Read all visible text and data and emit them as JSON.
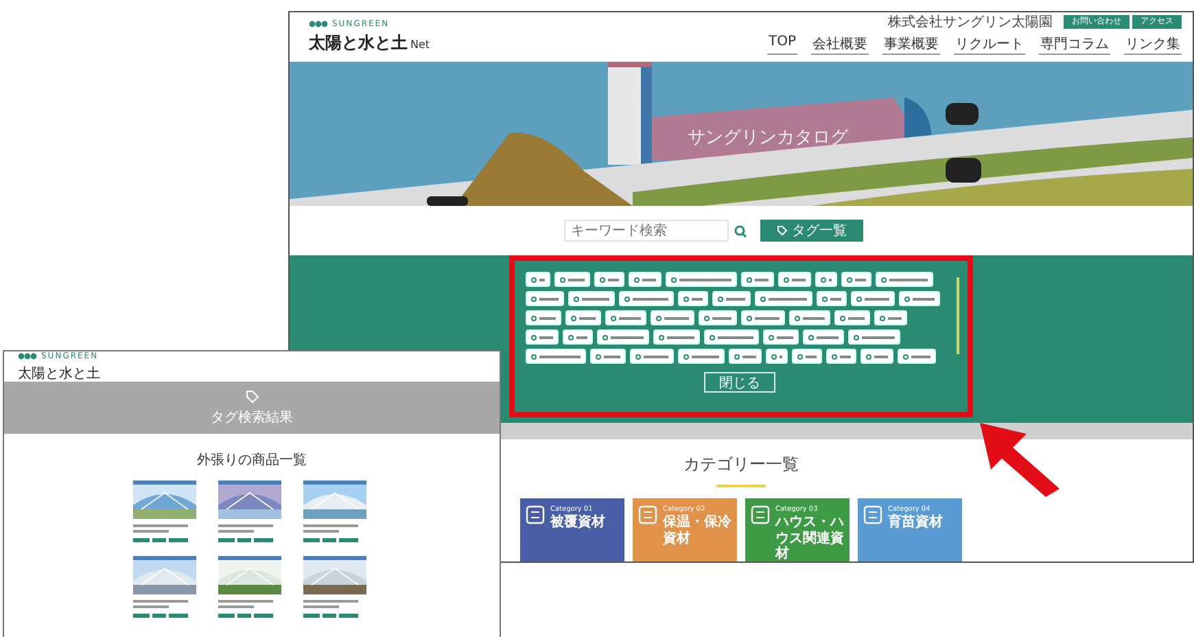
{
  "main_page": {
    "brand": "SUNGREEN",
    "site_title": "太陽と水と土",
    "site_title_suffix": "Net",
    "company": "株式会社サングリン太陽園",
    "header_buttons": [
      "お問い合わせ",
      "アクセス"
    ],
    "nav": [
      {
        "label": "TOP"
      },
      {
        "label": "会社概要"
      },
      {
        "label": "事業概要"
      },
      {
        "label": "リクルート"
      },
      {
        "label": "専門コラム"
      },
      {
        "label": "リンク集"
      }
    ],
    "hero_title": "サングリンカタログ",
    "search": {
      "placeholder": "キーワード検索"
    },
    "tag_list_button": "タグ一覧",
    "close_button": "閉じる",
    "category_heading": "カテゴリー一覧",
    "categories": [
      {
        "label": "Category 01",
        "name": "被覆資材",
        "color": "#4a5ea8"
      },
      {
        "label": "Category 02",
        "name": "保温・保冷資材",
        "color": "#e0914a"
      },
      {
        "label": "Category 03",
        "name": "ハウス・ハウス関連資材",
        "color": "#3e9a45"
      },
      {
        "label": "Category 04",
        "name": "育苗資材",
        "color": "#5a9bd4"
      }
    ]
  },
  "sub_page": {
    "brand": "SUNGREEN",
    "site_title": "太陽と水と土",
    "banner_title": "タグ検索結果",
    "list_heading": "外張りの商品一覧"
  }
}
